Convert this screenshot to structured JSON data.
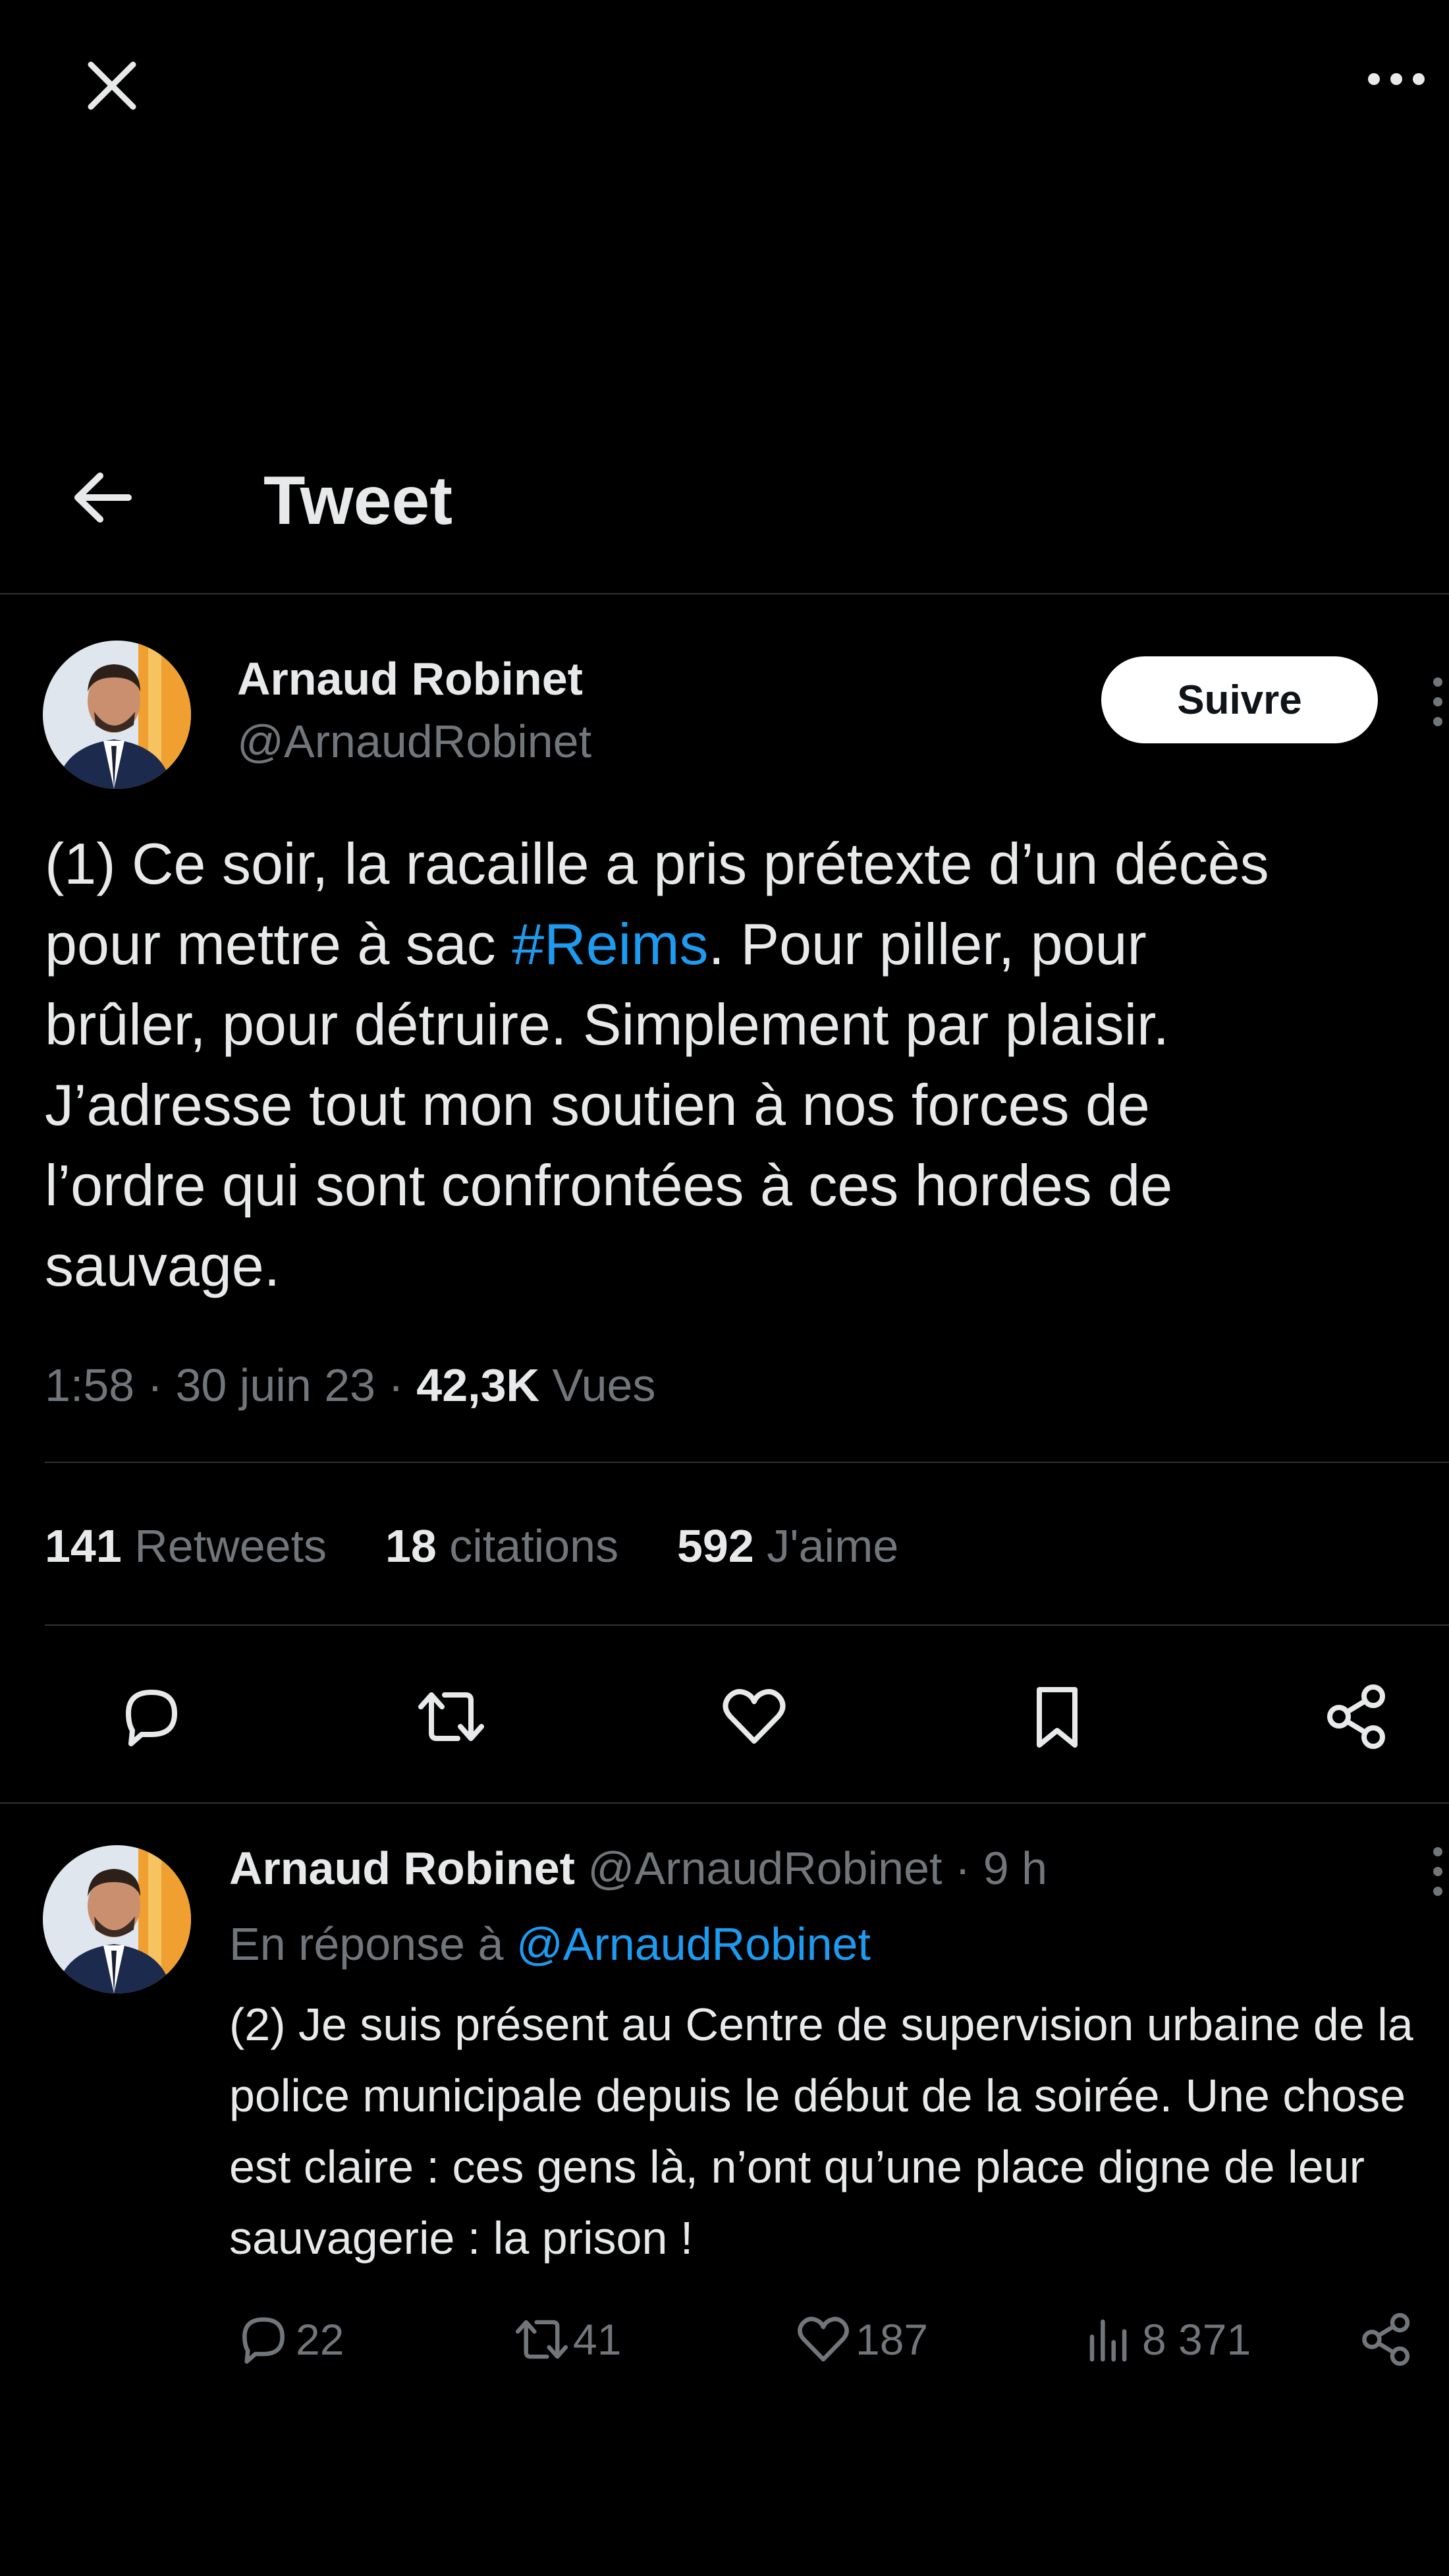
{
  "topbar": {
    "close_icon": "close-icon",
    "more_icon": "more-horizontal-icon"
  },
  "header": {
    "title": "Tweet",
    "back_icon": "arrow-left-icon"
  },
  "tweet": {
    "author_name": "Arnaud Robinet",
    "handle": "@ArnaudRobinet",
    "follow_label": "Suivre",
    "text_before": "(1) Ce soir, la racaille a pris prétexte d’un décès\npour mettre à sac ",
    "hashtag": "#Reims",
    "text_after": ". Pour piller, pour\nbrûler, pour détruire. Simplement par plaisir.\nJ’adresse tout mon soutien à nos forces de\nl’ordre qui sont confrontées à ces hordes de\nsauvage.",
    "time": "1:58",
    "date": "30 juin 23",
    "views_count": "42,3K",
    "views_label": "Vues",
    "sep": "·",
    "retweets_count": "141",
    "retweets_label": "Retweets",
    "quotes_count": "18",
    "quotes_label": "citations",
    "likes_count": "592",
    "likes_label": "J'aime"
  },
  "reply": {
    "author_name": "Arnaud Robinet",
    "handle": "@ArnaudRobinet",
    "age": "· 9 h",
    "in_reply_prefix": "En réponse à",
    "in_reply_handle": "@ArnaudRobinet",
    "text": "(2) Je suis présent au Centre de supervision urbaine de la police municipale depuis le début de la soirée. Une chose est claire : ces gens là, n’ont qu’une place digne de leur sauvagerie : la prison !",
    "replies": "22",
    "retweets": "41",
    "likes": "187",
    "views": "8 371"
  },
  "colors": {
    "background": "#000000",
    "link": "#1d9bf0",
    "muted": "#71767b",
    "divider": "#2f3336"
  }
}
